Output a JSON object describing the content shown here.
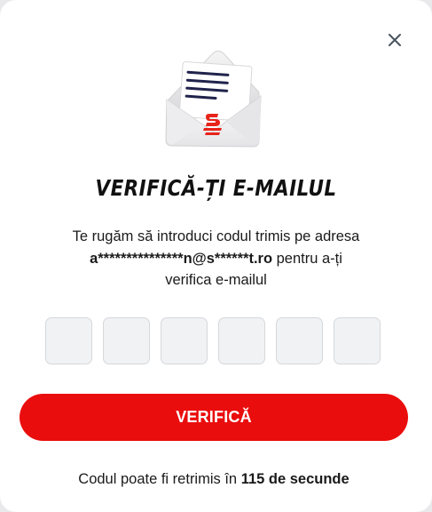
{
  "dialog": {
    "close_icon": "close-icon",
    "illustration_icon": "envelope-letter-icon",
    "brand_mark": "S",
    "title": "VERIFICĂ-ȚI E-MAILUL",
    "desc_line1": "Te rugăm să introduci codul trimis pe adresa",
    "email_masked": "a***************n@s******t.ro",
    "desc_line2_rest": " pentru a-ți",
    "desc_line3": "verifica e-mailul",
    "code_boxes": [
      "",
      "",
      "",
      "",
      "",
      ""
    ],
    "verify_label": "VERIFICĂ",
    "resend_prefix": "Codul poate fi retrimis în ",
    "resend_countdown": "115 de secunde"
  },
  "colors": {
    "primary": "#ea0d0d",
    "text": "#1a1a1a",
    "box_bg": "#f1f2f4",
    "box_border": "#d6d8dc"
  }
}
